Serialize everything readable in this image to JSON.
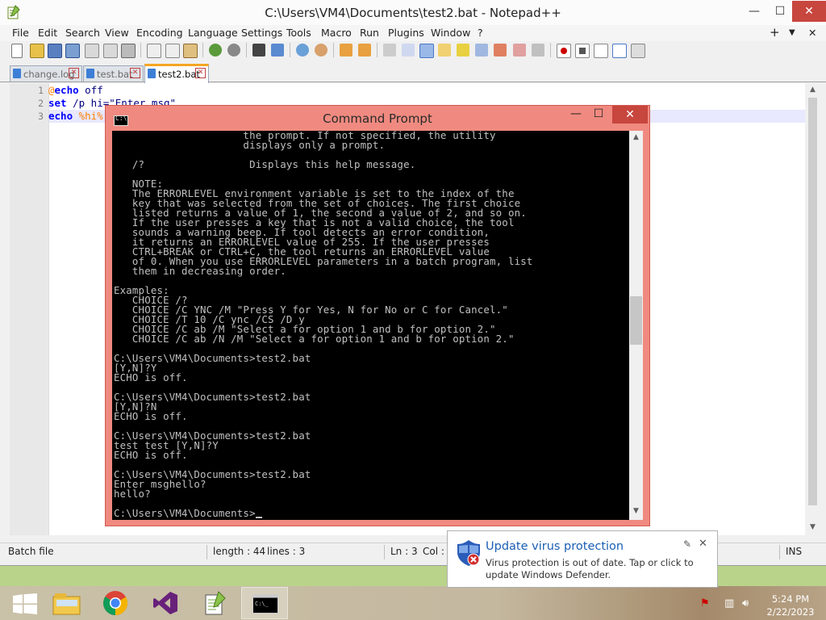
{
  "notepad": {
    "title": "C:\\Users\\VM4\\Documents\\test2.bat - Notepad++",
    "window_controls": {
      "minimize": "—",
      "maximize": "☐",
      "close": "✕"
    },
    "menu": [
      "File",
      "Edit",
      "Search",
      "View",
      "Encoding",
      "Language",
      "Settings",
      "Tools",
      "Macro",
      "Run",
      "Plugins",
      "Window",
      "?"
    ],
    "menu_right": {
      "plus": "+",
      "down": "▼",
      "close": "✕"
    },
    "tabs": [
      {
        "label": "change.log",
        "active": false
      },
      {
        "label": "test.bat",
        "active": false
      },
      {
        "label": "test2.bat",
        "active": true
      }
    ],
    "lines": [
      {
        "number": "1",
        "at": "@",
        "kw": "echo",
        "rest": " off"
      },
      {
        "number": "2",
        "kw": "set",
        "rest": " /p hi=\"Enter msg\""
      },
      {
        "number": "3",
        "kw": "echo",
        "rest": " %hi%"
      }
    ],
    "status": {
      "file_type": "Batch file",
      "length": "length : 44",
      "lines": "lines : 3",
      "ln": "Ln : 3",
      "col": "Col :",
      "mode": "INS"
    }
  },
  "cmd": {
    "title": "Command Prompt",
    "icon_text": "C:\\",
    "window_controls": {
      "minimize": "—",
      "maximize": "☐",
      "close": "✕"
    },
    "console_lines": [
      "                     the prompt. If not specified, the utility",
      "                     displays only a prompt.",
      "",
      "   /?                 Displays this help message.",
      "",
      "   NOTE:",
      "   The ERRORLEVEL environment variable is set to the index of the",
      "   key that was selected from the set of choices. The first choice",
      "   listed returns a value of 1, the second a value of 2, and so on.",
      "   If the user presses a key that is not a valid choice, the tool",
      "   sounds a warning beep. If tool detects an error condition,",
      "   it returns an ERRORLEVEL value of 255. If the user presses",
      "   CTRL+BREAK or CTRL+C, the tool returns an ERRORLEVEL value",
      "   of 0. When you use ERRORLEVEL parameters in a batch program, list",
      "   them in decreasing order.",
      "",
      "Examples:",
      "   CHOICE /?",
      "   CHOICE /C YNC /M \"Press Y for Yes, N for No or C for Cancel.\"",
      "   CHOICE /T 10 /C ync /CS /D y",
      "   CHOICE /C ab /M \"Select a for option 1 and b for option 2.\"",
      "   CHOICE /C ab /N /M \"Select a for option 1 and b for option 2.\"",
      "",
      "C:\\Users\\VM4\\Documents>test2.bat",
      "[Y,N]?Y",
      "ECHO is off.",
      "",
      "C:\\Users\\VM4\\Documents>test2.bat",
      "[Y,N]?N",
      "ECHO is off.",
      "",
      "C:\\Users\\VM4\\Documents>test2.bat",
      "test test [Y,N]?Y",
      "ECHO is off.",
      "",
      "C:\\Users\\VM4\\Documents>test2.bat",
      "Enter msghello?",
      "hello?",
      ""
    ],
    "prompt": "C:\\Users\\VM4\\Documents>"
  },
  "notification": {
    "title": "Update virus protection",
    "message": "Virus protection is out of date. Tap or click to update Windows Defender."
  },
  "taskbar": {
    "apps": [
      "start",
      "file-explorer",
      "chrome",
      "visual-studio",
      "notepad-plus-plus",
      "command-prompt"
    ],
    "time": "5:24 PM",
    "date": "2/22/2023"
  },
  "colors": {
    "cmd_frame": "#f08a80",
    "console_bg": "#000000",
    "console_fg": "#c0c0c0",
    "toast_title": "#1a5fb4",
    "npp_keyword": "#0000ff"
  }
}
